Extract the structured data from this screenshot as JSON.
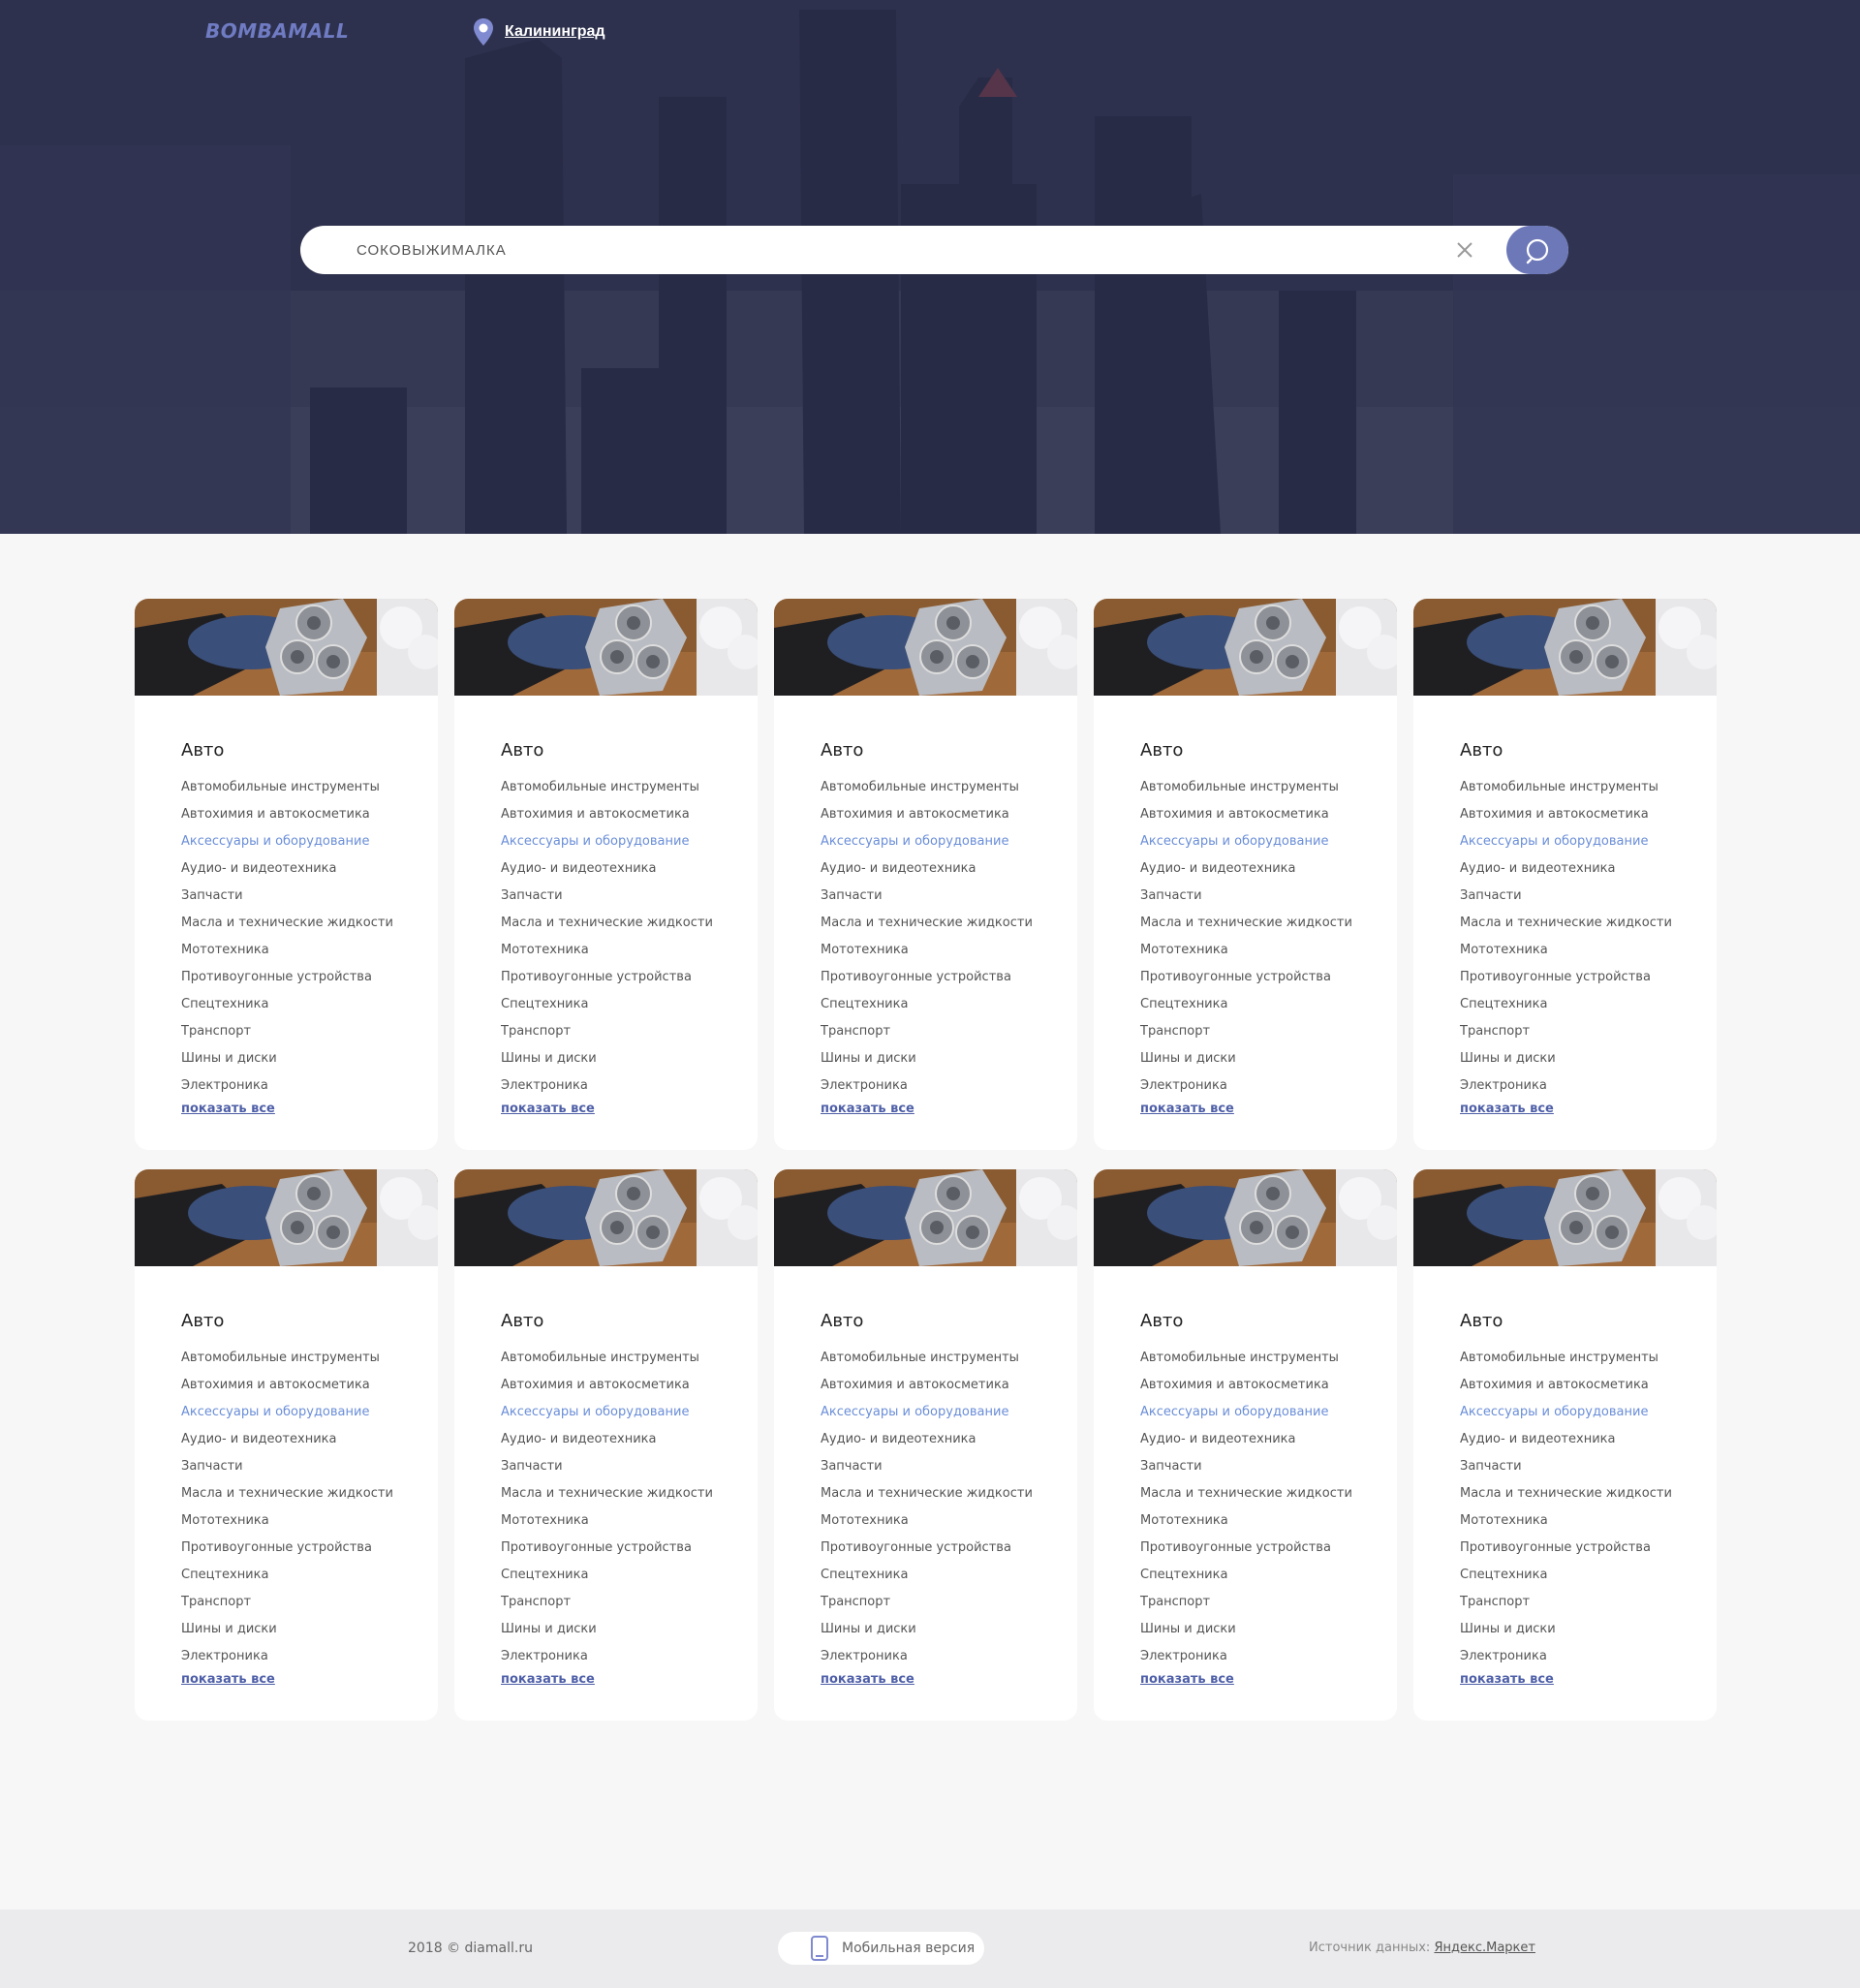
{
  "header": {
    "logo": "BOMBAMALL",
    "city": "Калининград"
  },
  "search": {
    "value": "СОКОВЫЖИМАЛКА"
  },
  "card": {
    "title": "Авто",
    "items": [
      "Автомобильные инструменты",
      "Автохимия и автокосметика",
      "Аксессуары и оборудование",
      "Аудио- и видеотехника",
      "Запчасти",
      "Масла и технические жидкости",
      "Мототехника",
      "Противоугонные устройства",
      "Спецтехника",
      "Транспорт",
      "Шины и диски",
      "Электроника"
    ],
    "active_index": 2,
    "show_all": "показать все"
  },
  "cards_count": 10,
  "footer": {
    "copyright": "2018 © diamall.ru",
    "mobile_label": "Мобильная версия",
    "source_label": "Источник данных:",
    "source_link": "Яндекс.Маркет"
  },
  "colors": {
    "accent": "#6d78b8",
    "link_active": "#6a8ed8",
    "show_all": "#4e5fa8",
    "hero_bg": "#2f3250"
  },
  "icons": [
    "location-pin-icon",
    "clear-icon",
    "search-icon",
    "phone-icon"
  ]
}
